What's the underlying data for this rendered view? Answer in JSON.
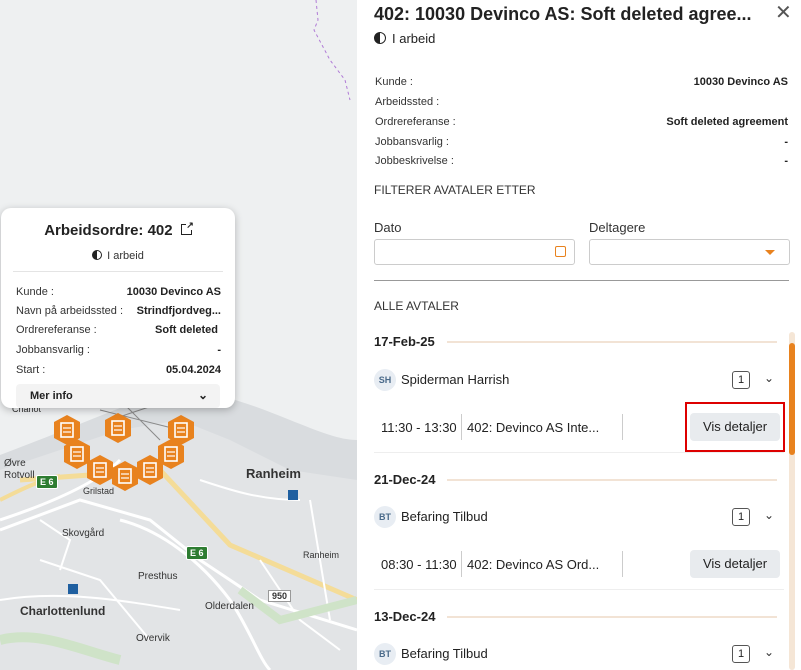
{
  "map": {
    "labels": {
      "ranheim": "Ranheim",
      "charlottenlund": "Charlottenlund",
      "skovgard": "Skovgård",
      "presthus": "Presthus",
      "olderdalen": "Olderdalen",
      "overvik": "Overvik",
      "rotvoll": "Rotvoll",
      "ovre": "Øvre",
      "grilstad": "Grilstad",
      "charlot_short": "Charlot",
      "ranheim_small": "Ranheim"
    },
    "signs": {
      "e6a": "E 6",
      "e6b": "E 6",
      "r950": "950"
    }
  },
  "popup": {
    "title": "Arbeidsordre: 402",
    "status": "I arbeid",
    "rows": [
      {
        "label": "Kunde :",
        "value": "10030 Devinco AS"
      },
      {
        "label": "Navn på arbeidssted :",
        "value": "Strindfjordveg..."
      },
      {
        "label": "Ordrereferanse :",
        "value": "Soft deleted"
      },
      {
        "label": "Jobbansvarlig :",
        "value": "-"
      },
      {
        "label": "Start :",
        "value": "05.04.2024"
      }
    ],
    "more": "Mer info"
  },
  "panel": {
    "title": "402: 10030 Devinco AS: Soft deleted agree...",
    "status": "I arbeid",
    "info": [
      {
        "label": "Kunde :",
        "value": "10030 Devinco AS"
      },
      {
        "label": "Arbeidssted :",
        "value": ""
      },
      {
        "label": "Ordrereferanse :",
        "value": "Soft deleted agreement"
      },
      {
        "label": "Jobbansvarlig :",
        "value": "-"
      },
      {
        "label": "Jobbeskrivelse :",
        "value": "-"
      }
    ],
    "filter_title": "FILTERER AVATALER ETTER",
    "date_label": "Dato",
    "participants_label": "Deltagere",
    "all_title": "ALLE AVTALER",
    "groups": [
      {
        "date": "17-Feb-25",
        "initials": "SH",
        "name": "Spiderman Harrish",
        "count": "1",
        "time": "11:30 - 13:30",
        "desc": "402: Devinco AS Inte...",
        "button": "Vis detaljer"
      },
      {
        "date": "21-Dec-24",
        "initials": "BT",
        "name": "Befaring Tilbud",
        "count": "1",
        "time": "08:30 - 11:30",
        "desc": "402: Devinco AS Ord...",
        "button": "Vis detaljer"
      },
      {
        "date": "13-Dec-24",
        "initials": "BT",
        "name": "Befaring Tilbud",
        "count": "1"
      }
    ]
  },
  "colors": {
    "accent": "#e8821e",
    "highlight": "#dd0000"
  }
}
